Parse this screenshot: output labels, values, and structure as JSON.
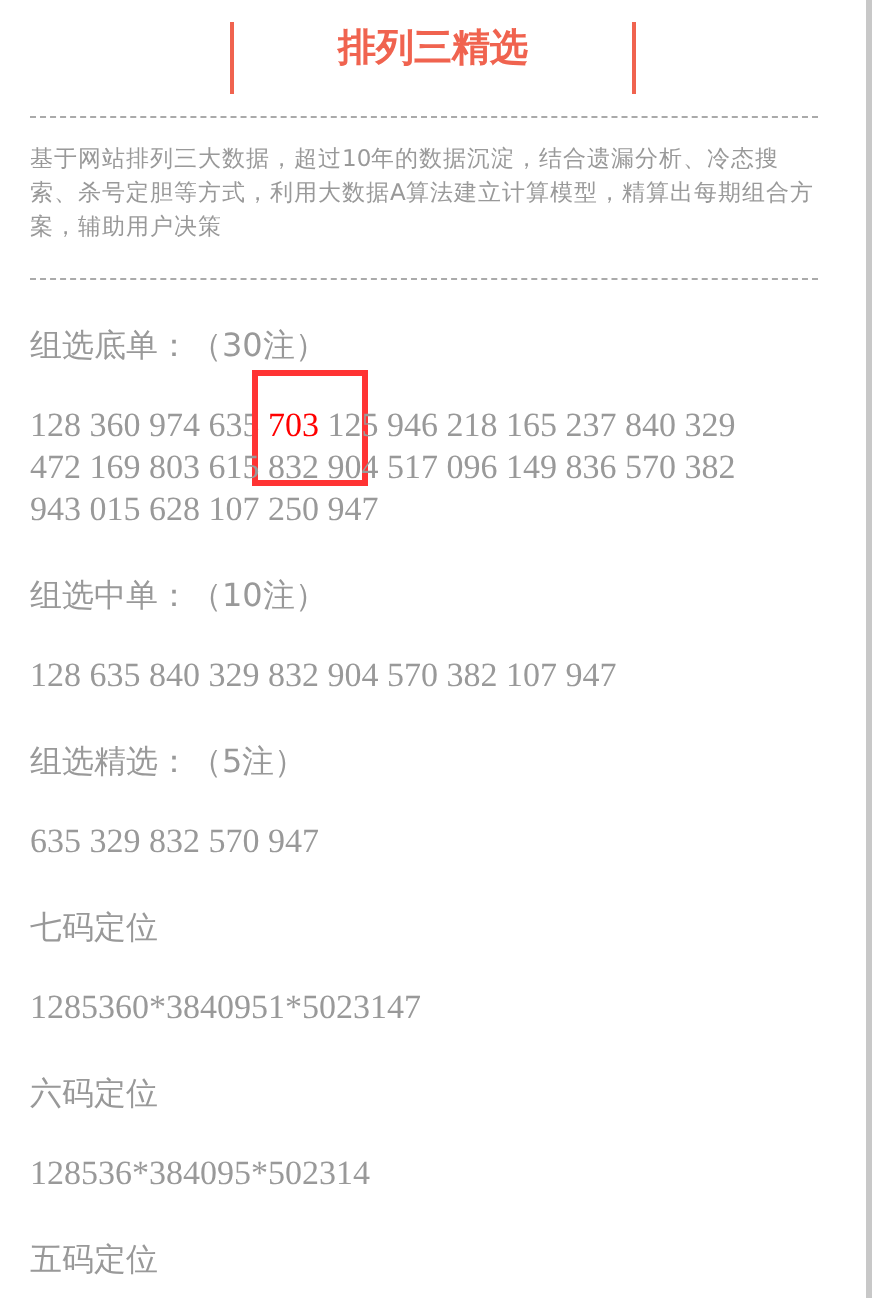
{
  "header": {
    "title": "排列三精选"
  },
  "description": "基于网站排列三大数据，超过10年的数据沉淀，结合遗漏分析、冷态搜索、杀号定胆等方式，利用大数据A算法建立计算模型，精算出每期组合方案，辅助用户决策",
  "sections": [
    {
      "heading": "组选底单：（30注）",
      "numbers": [
        {
          "text": "128",
          "highlighted": false
        },
        {
          "text": "360",
          "highlighted": false
        },
        {
          "text": "974",
          "highlighted": false
        },
        {
          "text": "635",
          "highlighted": false
        },
        {
          "text": "703",
          "highlighted": true
        },
        {
          "text": "125",
          "highlighted": false
        },
        {
          "text": "946",
          "highlighted": false
        },
        {
          "text": "218",
          "highlighted": false
        },
        {
          "text": "165",
          "highlighted": false
        },
        {
          "text": "237",
          "highlighted": false
        },
        {
          "text": "840",
          "highlighted": false
        },
        {
          "text": "329",
          "highlighted": false
        },
        {
          "text": "472",
          "highlighted": false
        },
        {
          "text": "169",
          "highlighted": false
        },
        {
          "text": "803",
          "highlighted": false
        },
        {
          "text": "615",
          "highlighted": false
        },
        {
          "text": "832",
          "highlighted": false
        },
        {
          "text": "904",
          "highlighted": false
        },
        {
          "text": "517",
          "highlighted": false
        },
        {
          "text": "096",
          "highlighted": false
        },
        {
          "text": "149",
          "highlighted": false
        },
        {
          "text": "836",
          "highlighted": false
        },
        {
          "text": "570",
          "highlighted": false
        },
        {
          "text": "382",
          "highlighted": false
        },
        {
          "text": "943",
          "highlighted": false
        },
        {
          "text": "015",
          "highlighted": false
        },
        {
          "text": "628",
          "highlighted": false
        },
        {
          "text": "107",
          "highlighted": false
        },
        {
          "text": "250",
          "highlighted": false
        },
        {
          "text": "947",
          "highlighted": false
        }
      ]
    },
    {
      "heading": "组选中单：（10注）",
      "text": "128 635 840 329 832 904 570 382 107 947"
    },
    {
      "heading": "组选精选：（5注）",
      "text": "635 329 832 570 947"
    },
    {
      "heading": "七码定位",
      "text": "1285360*3840951*5023147"
    },
    {
      "heading": "六码定位",
      "text": "128536*384095*502314"
    },
    {
      "heading": "五码定位"
    }
  ]
}
